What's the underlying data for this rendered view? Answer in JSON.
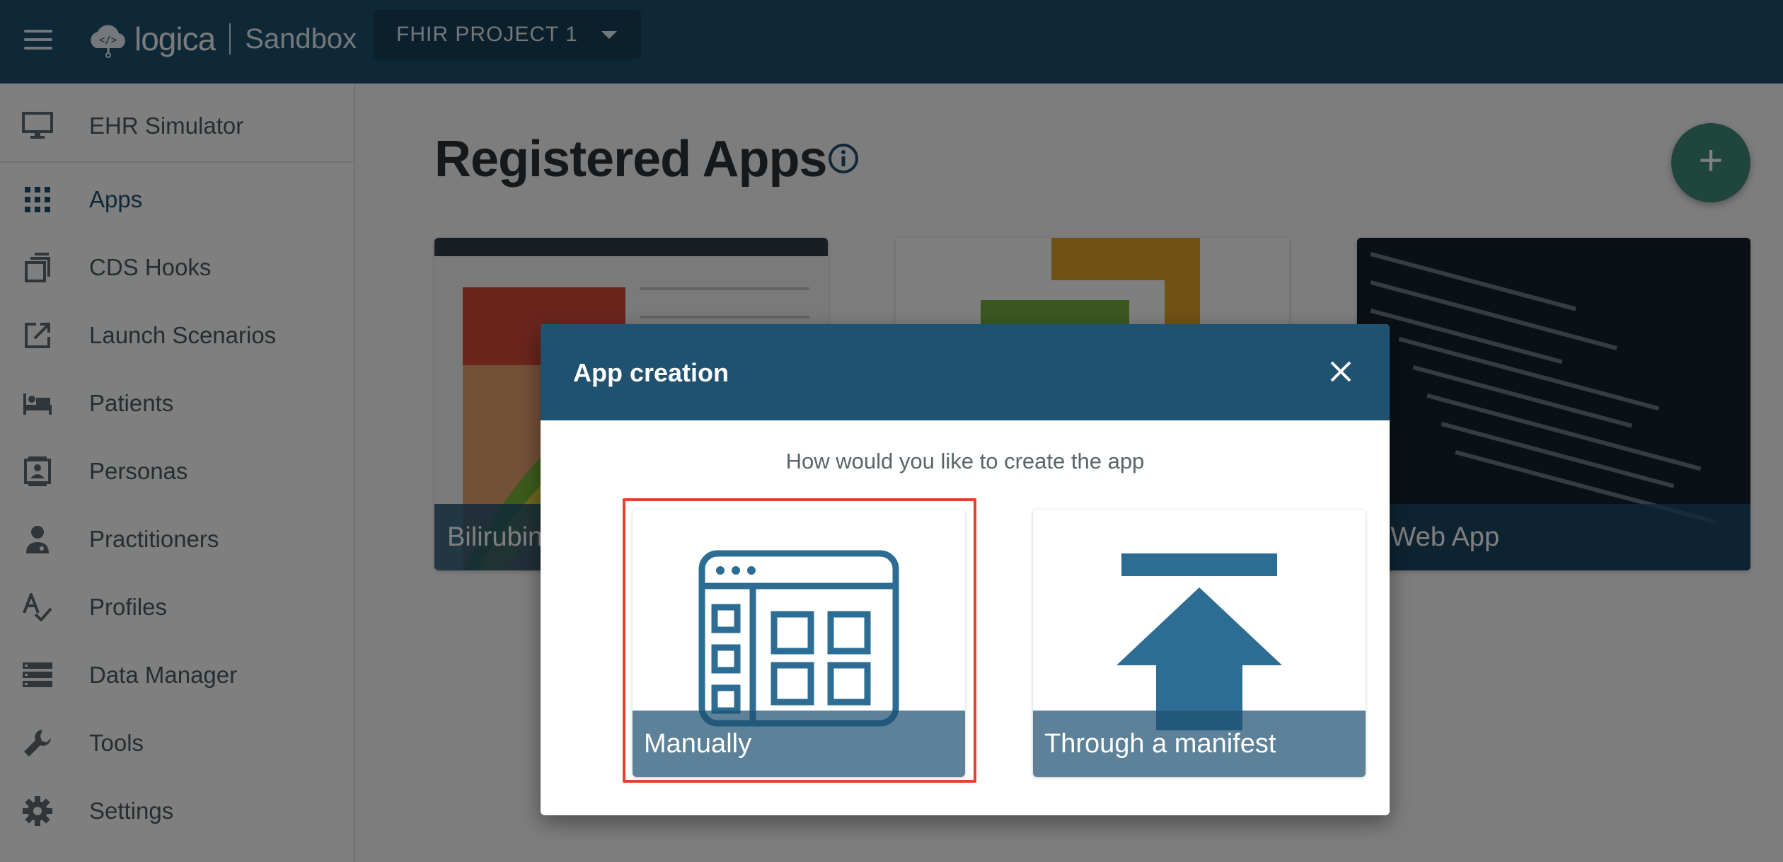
{
  "topbar": {
    "logo_text": "logica",
    "logo_product": "Sandbox",
    "project_name": "FHIR PROJECT 1"
  },
  "sidebar": {
    "items": [
      {
        "label": "EHR Simulator",
        "icon": "monitor-icon"
      },
      {
        "label": "Apps",
        "icon": "apps-grid-icon",
        "active": true
      },
      {
        "label": "CDS Hooks",
        "icon": "cds-hooks-icon"
      },
      {
        "label": "Launch Scenarios",
        "icon": "launch-icon"
      },
      {
        "label": "Patients",
        "icon": "patient-bed-icon"
      },
      {
        "label": "Personas",
        "icon": "persona-icon"
      },
      {
        "label": "Practitioners",
        "icon": "practitioner-icon"
      },
      {
        "label": "Profiles",
        "icon": "profiles-icon"
      },
      {
        "label": "Data Manager",
        "icon": "data-manager-icon"
      },
      {
        "label": "Tools",
        "icon": "wrench-icon"
      },
      {
        "label": "Settings",
        "icon": "gear-icon"
      }
    ]
  },
  "main": {
    "title": "Registered Apps",
    "fab_label": "+",
    "apps": [
      {
        "name": "Bilirubin"
      },
      {
        "name": ""
      },
      {
        "name": "y Web App"
      }
    ]
  },
  "dialog": {
    "title": "App creation",
    "question": "How would you like to create the app",
    "options": [
      {
        "label": "Manually",
        "icon": "manual-app-icon"
      },
      {
        "label": "Through a manifest",
        "icon": "upload-manifest-icon"
      }
    ]
  },
  "colors": {
    "primary": "#1f5170",
    "accent": "#3e8a7b",
    "highlight": "#e0442c"
  }
}
